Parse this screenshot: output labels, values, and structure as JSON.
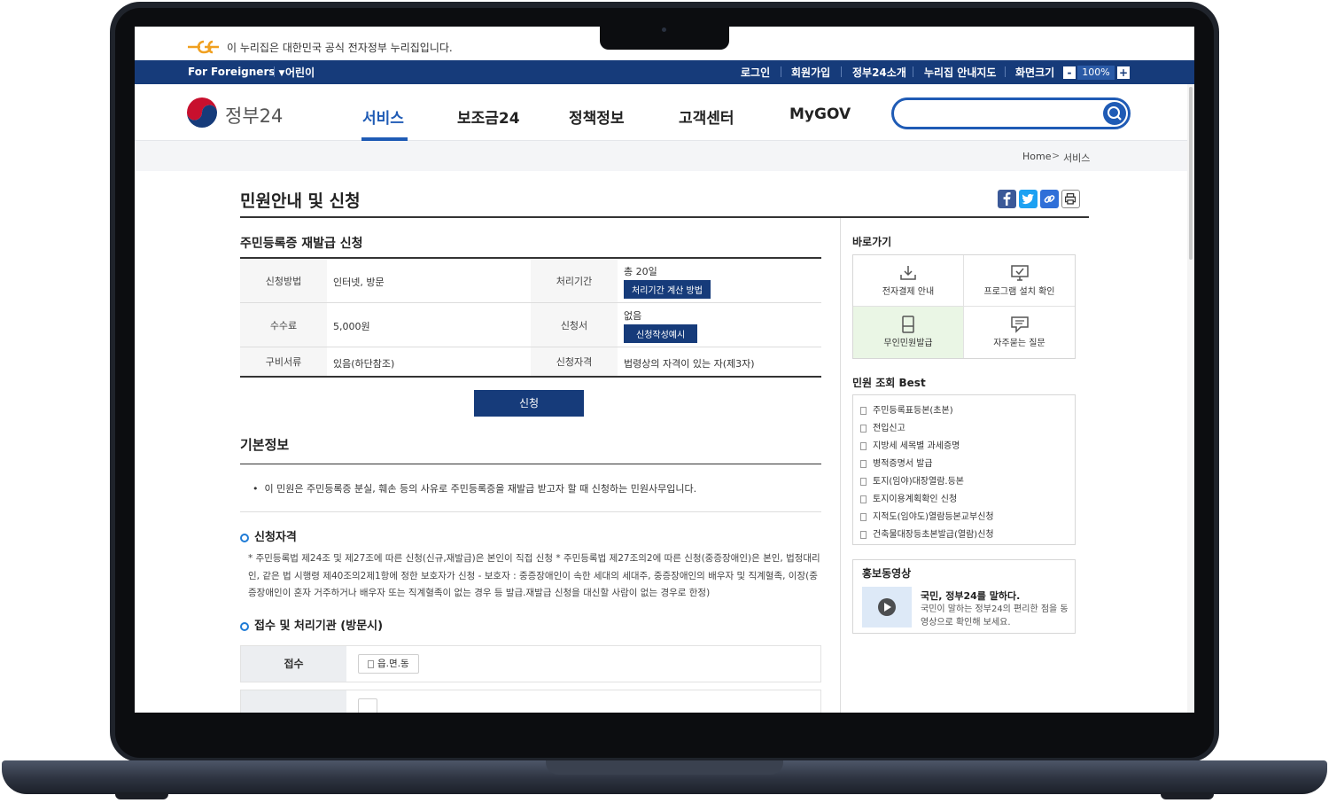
{
  "gov_banner": {
    "text": "이 누리집은 대한민국 공식 전자정부 누리집입니다."
  },
  "topbar": {
    "language": "For Foreigners",
    "kids": "어린이",
    "utils": [
      "로그인",
      "회원가입",
      "정부24소개",
      "누리집 안내지도",
      "화면크기"
    ],
    "zoom_minus": "-",
    "zoom_value": "100%",
    "zoom_plus": "+"
  },
  "header": {
    "brand": "정부24",
    "nav": [
      "서비스",
      "보조금24",
      "정책정보",
      "고객센터",
      "MyGOV"
    ],
    "active_nav": "서비스",
    "search": {
      "value": "",
      "placeholder": ""
    }
  },
  "breadcrumb": {
    "home": "Home",
    "separator": ">",
    "current": "서비스"
  },
  "page": {
    "title": "민원안내 및 신청",
    "service_title": "주민등록증 재발급 신청",
    "info": {
      "method_label": "신청방법",
      "method_value": "인터넷, 방문",
      "period_label": "처리기간",
      "period_value": "총 20일",
      "period_button": "처리기간 계산 방법",
      "fee_label": "수수료",
      "fee_value": "5,000원",
      "form_label": "신청서",
      "form_value": "없음",
      "form_button": "신청작성예시",
      "docs_label": "구비서류",
      "docs_value": "있음(하단참조)",
      "qual_label": "신청자격",
      "qual_value": "법령상의 자격이 있는 자(제3자)"
    },
    "apply_button": "신청",
    "basic_info": {
      "title": "기본정보",
      "text": "이 민원은 주민등록증 분실, 훼손 등의 사유로 주민등록증을 재발급 받고자 할 때 신청하는 민원사무입니다."
    },
    "qualification": {
      "title": "신청자격",
      "text": "* 주민등록법 제24조 및 제27조에 따른 신청(신규,재발급)은 본인이 직접 신청 * 주민등록법 제27조의2에 따른 신청(중증장애인)은 본인, 법정대리인, 같은 법 시행령 제40조의2제1항에 정한 보호자가 신청 - 보호자 : 중증장애인이 속한 세대의 세대주, 중증장애인의 배우자 및 직계혈족, 이장(중증장애인이 혼자 거주하거나 배우자 또는 직계혈족이 없는 경우 등 발급.재발급 신청을 대신할 사람이 없는 경우로 한정)"
    },
    "organization": {
      "title": "접수 및 처리기관 (방문시)",
      "reception_label": "접수",
      "reception_value": "읍.면.동"
    }
  },
  "sidebar": {
    "quick_title": "바로가기",
    "quick_links": [
      "전자결제 안내",
      "프로그램 설치 확인",
      "무인민원발급",
      "자주묻는 질문"
    ],
    "best_title": "민원 조회 Best",
    "best_items": [
      "주민등록표등본(초본)",
      "전입신고",
      "지방세 세목별 과세증명",
      "병적증명서 발급",
      "토지(임야)대장열람.등본",
      "토지이용계획확인 신청",
      "지적도(임야도)열람등본교부신청",
      "건축물대장등초본발급(열람)신청"
    ],
    "promo": {
      "title": "홍보동영상",
      "headline": "국민, 정부24를 말하다.",
      "desc": "국민이 말하는 정부24의 편리한 점을 동영상으로 확인해 보세요."
    }
  },
  "colors": {
    "navy": "#163b7a",
    "accent_blue": "#1f5bb5",
    "highlight_green": "#eaf6e5",
    "facebook": "#3b5998",
    "twitter": "#1da1f2"
  }
}
